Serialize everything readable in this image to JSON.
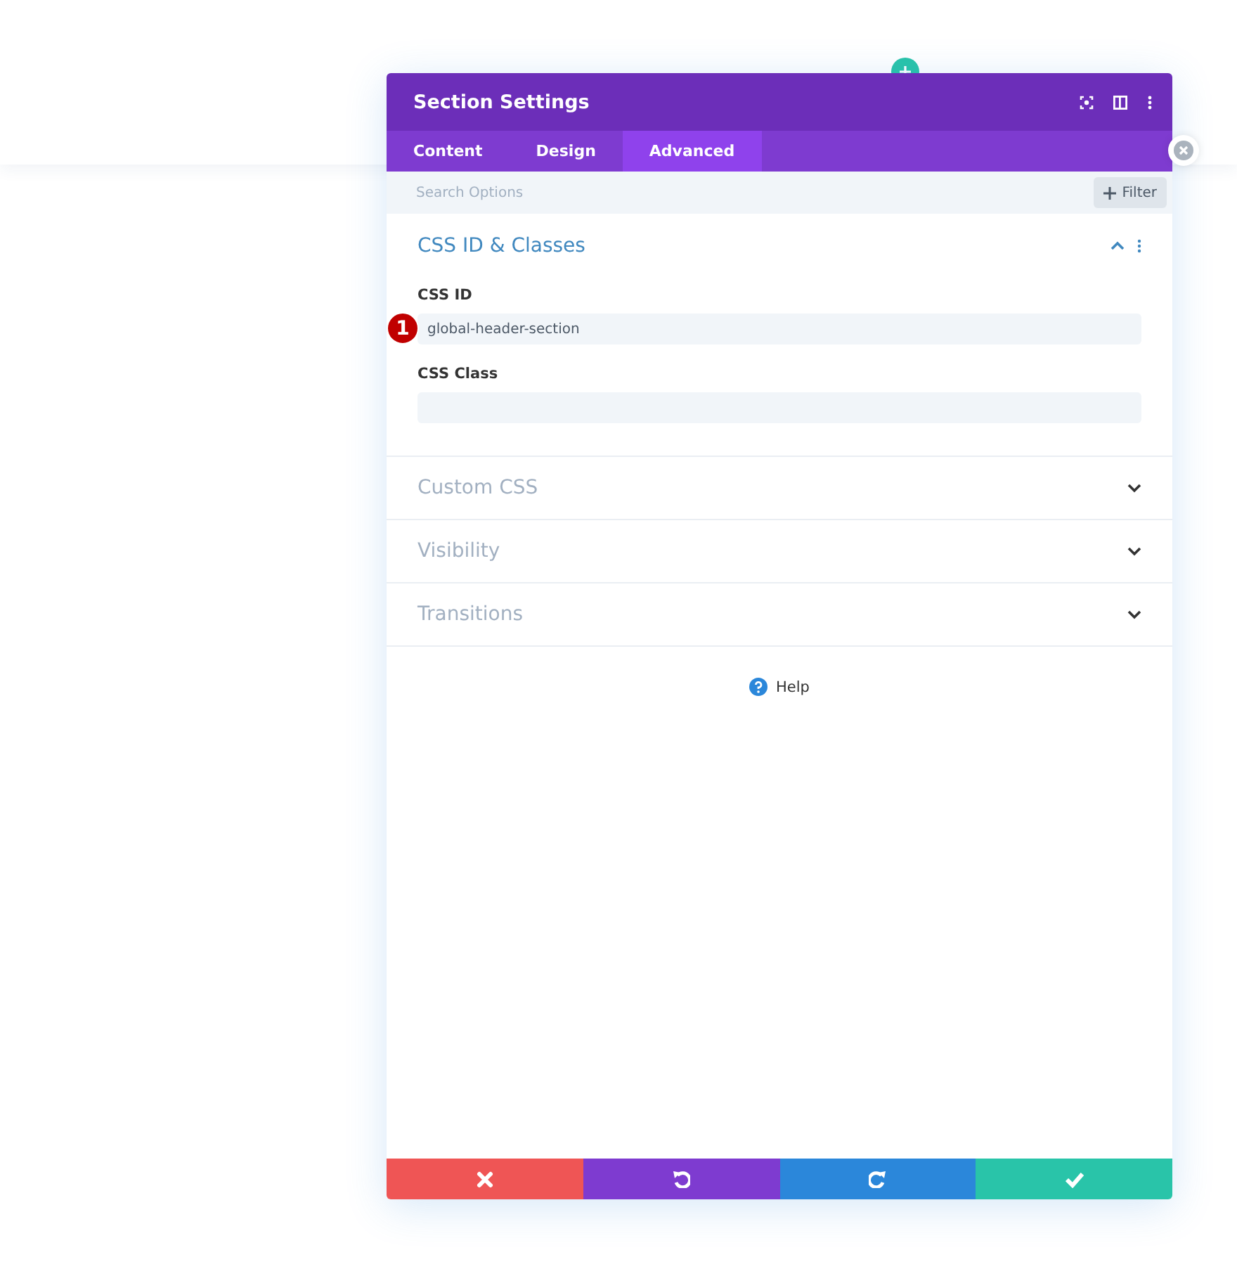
{
  "window": {
    "title": "Section Settings"
  },
  "tabs": [
    {
      "label": "Content",
      "selected": false
    },
    {
      "label": "Design",
      "selected": false
    },
    {
      "label": "Advanced",
      "selected": true
    }
  ],
  "search": {
    "placeholder": "Search Options"
  },
  "filter_button": "Filter",
  "sections": [
    {
      "title": "CSS ID & Classes",
      "expanded": true,
      "fields": [
        {
          "label": "CSS ID",
          "value": "global-header-section",
          "marker": "1"
        },
        {
          "label": "CSS Class"
        }
      ]
    },
    {
      "title": "Custom CSS",
      "expanded": false
    },
    {
      "title": "Visibility",
      "expanded": false
    },
    {
      "title": "Transitions",
      "expanded": false
    }
  ],
  "help": "Help",
  "footer_buttons": [
    {
      "kind": "cancel"
    },
    {
      "kind": "undo"
    },
    {
      "kind": "redo"
    },
    {
      "kind": "save"
    }
  ]
}
